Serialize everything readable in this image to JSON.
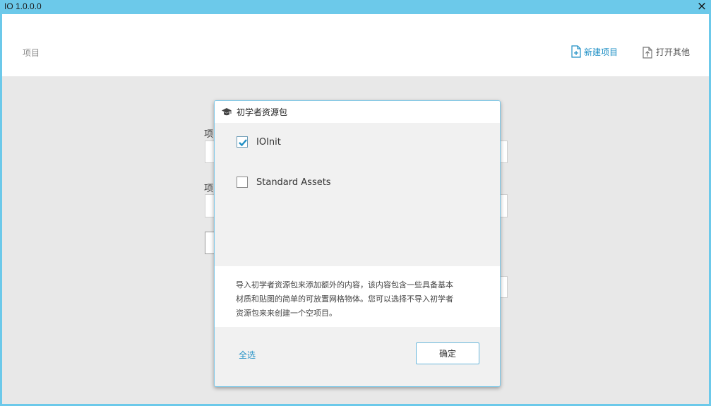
{
  "window": {
    "title": "IO 1.0.0.0",
    "close_icon": "×"
  },
  "header": {
    "projects_label": "项目",
    "new_project_label": "新建项目",
    "open_other_label": "打开其他",
    "new_project_icon": "new-file-icon",
    "open_other_icon": "open-file-icon"
  },
  "background_form": {
    "label_1": "项",
    "label_2": "项"
  },
  "dialog": {
    "title": "初学者资源包",
    "title_icon": "graduation-cap-icon",
    "packages": [
      {
        "label": "IOInit",
        "checked": true
      },
      {
        "label": "Standard Assets",
        "checked": false
      }
    ],
    "description_lines": [
      "导入初学者资源包来添加额外的内容，该内容包含一些具备基本",
      "材质和贴图的简单的可放置网格物体。您可以选择不导入初学者",
      "资源包来来创建一个空项目。"
    ],
    "select_all_label": "全选",
    "ok_label": "确定"
  },
  "colors": {
    "accent": "#1e8fc5",
    "titlebar": "#6cc9ea",
    "check": "#1e8fc5"
  }
}
